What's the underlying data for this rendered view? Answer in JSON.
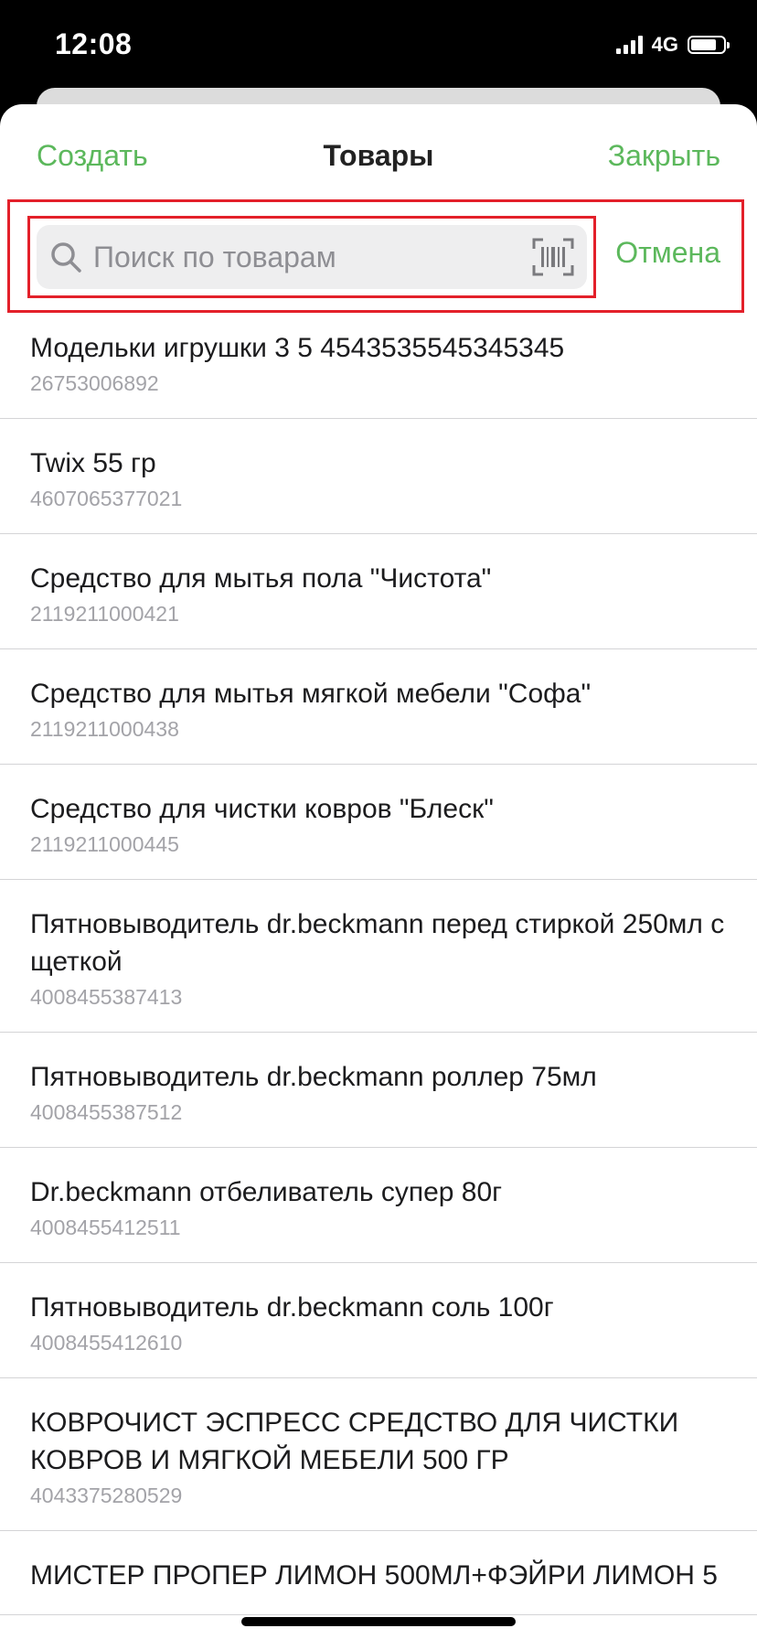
{
  "status_bar": {
    "time": "12:08",
    "network": "4G",
    "signal_bars": 4,
    "battery_level": 0.8
  },
  "nav": {
    "create_label": "Создать",
    "title": "Товары",
    "close_label": "Закрыть"
  },
  "search": {
    "placeholder": "Поиск по товарам",
    "value": "",
    "cancel_label": "Отмена"
  },
  "products": [
    {
      "name": "Модельки игрушки 3 5 4543535545345345",
      "code": "26753006892"
    },
    {
      "name": "Twix 55 гр",
      "code": "4607065377021"
    },
    {
      "name": "Средство для мытья пола \"Чистота\"",
      "code": "2119211000421"
    },
    {
      "name": "Средство для мытья мягкой мебели \"Софа\"",
      "code": "2119211000438"
    },
    {
      "name": "Средство для чистки ковров \"Блеск\"",
      "code": "2119211000445"
    },
    {
      "name": "Пятновыводитель dr.beckmann перед стиркой 250мл с щеткой",
      "code": "4008455387413"
    },
    {
      "name": "Пятновыводитель dr.beckmann роллер 75мл",
      "code": "4008455387512"
    },
    {
      "name": "Dr.beckmann отбеливатель супер 80г",
      "code": "4008455412511"
    },
    {
      "name": "Пятновыводитель dr.beckmann соль 100г",
      "code": "4008455412610"
    },
    {
      "name": "КОВРОЧИСТ ЭСПРЕСС СРЕДСТВО ДЛЯ ЧИСТКИ КОВРОВ И МЯГКОЙ МЕБЕЛИ 500 ГР",
      "code": "4043375280529"
    },
    {
      "name": "МИСТЕР ПРОПЕР ЛИМОН 500МЛ+ФЭЙРИ ЛИМОН 5",
      "code": ""
    }
  ],
  "colors": {
    "accent": "#5cb85c",
    "highlight": "#e3202a"
  }
}
